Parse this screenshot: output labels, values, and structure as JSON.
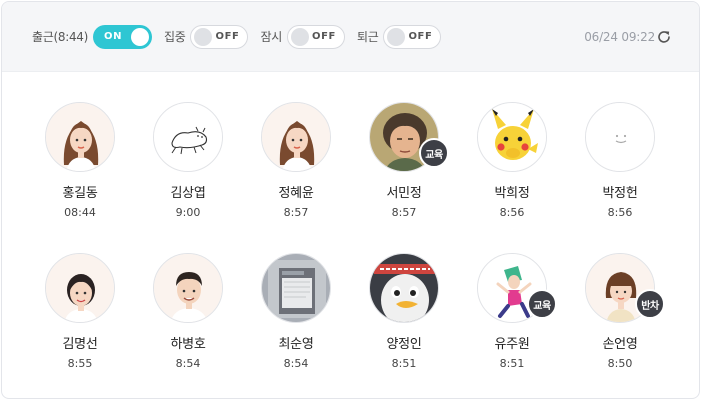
{
  "statuses": [
    {
      "label": "출근(8:44)",
      "state": "ON"
    },
    {
      "label": "집중",
      "state": "OFF"
    },
    {
      "label": "잠시",
      "state": "OFF"
    },
    {
      "label": "퇴근",
      "state": "OFF"
    }
  ],
  "datetime": "06/24 09:22",
  "colors": {
    "accent": "#2ec6d3",
    "badge": "#3d3f46",
    "header_bg": "#f5f6f8"
  },
  "people": [
    {
      "name": "홍길동",
      "time": "08:44",
      "avatar": "woman-long-hair",
      "badge": ""
    },
    {
      "name": "김상엽",
      "time": "9:00",
      "avatar": "sketch-animal",
      "badge": ""
    },
    {
      "name": "정혜윤",
      "time": "8:57",
      "avatar": "woman-long-hair",
      "badge": ""
    },
    {
      "name": "서민정",
      "time": "8:57",
      "avatar": "older-woman-photo",
      "badge": "교육"
    },
    {
      "name": "박희정",
      "time": "8:56",
      "avatar": "pikachu",
      "badge": ""
    },
    {
      "name": "박정헌",
      "time": "8:56",
      "avatar": "default-smile",
      "badge": ""
    },
    {
      "name": "김명선",
      "time": "8:55",
      "avatar": "woman-ponytail",
      "badge": ""
    },
    {
      "name": "하병호",
      "time": "8:54",
      "avatar": "man-short-hair",
      "badge": ""
    },
    {
      "name": "최순영",
      "time": "8:54",
      "avatar": "photo-document",
      "badge": ""
    },
    {
      "name": "양정인",
      "time": "8:51",
      "avatar": "penguin-photo",
      "badge": ""
    },
    {
      "name": "유주원",
      "time": "8:51",
      "avatar": "dancing-character",
      "badge": "교육"
    },
    {
      "name": "손언영",
      "time": "8:50",
      "avatar": "woman-bob-hair",
      "badge": "반차"
    }
  ]
}
